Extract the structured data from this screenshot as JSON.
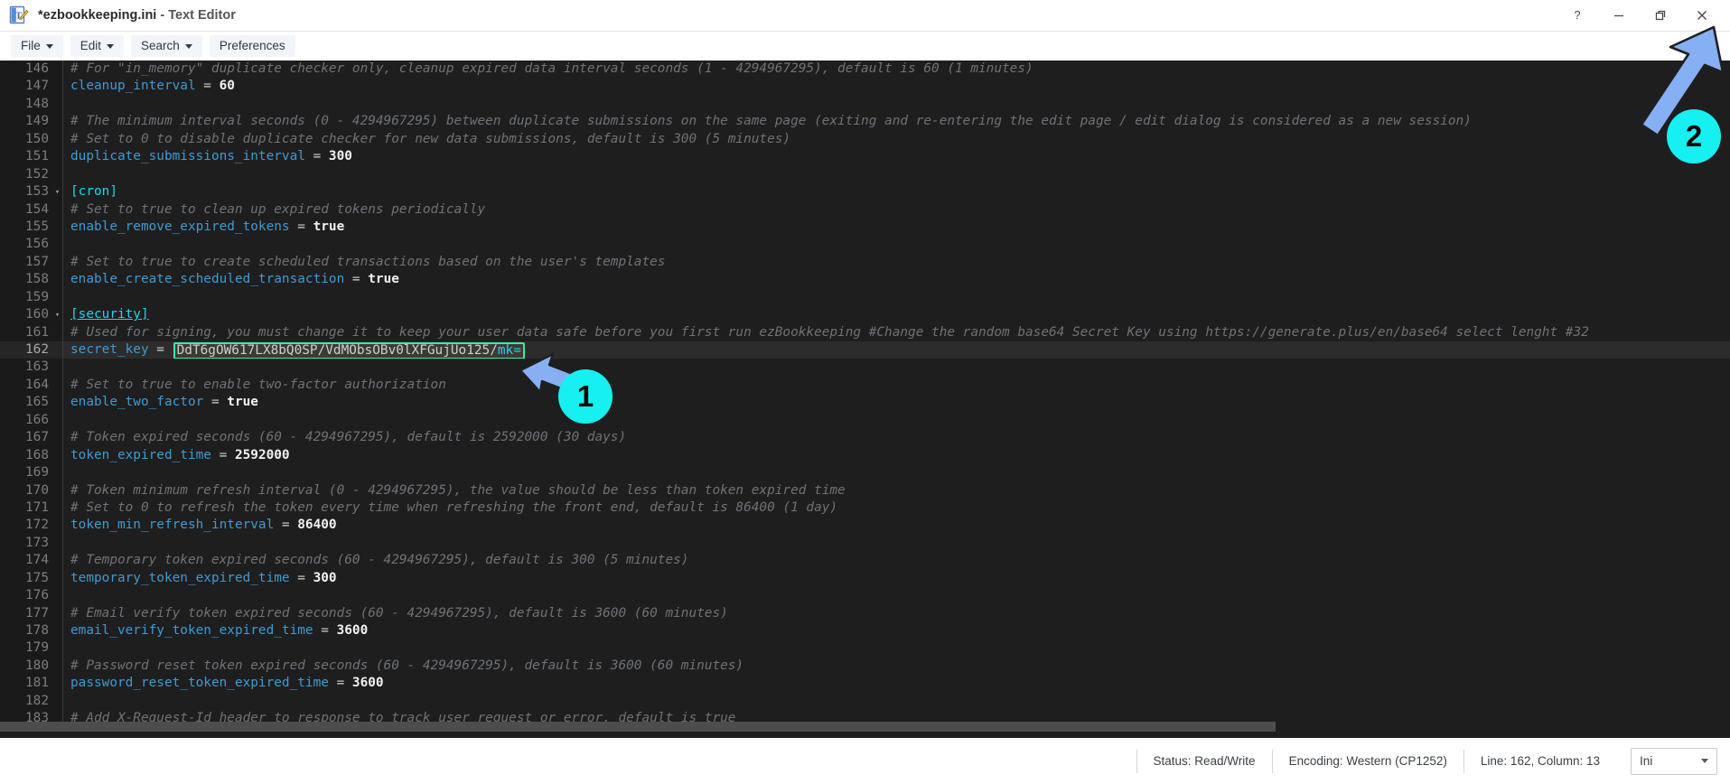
{
  "window": {
    "title": "*ezbookkeeping.ini",
    "title_suffix": " - Text Editor",
    "app_icon": "text-editor-icon",
    "controls": [
      {
        "name": "help-button",
        "glyph": "?"
      },
      {
        "name": "minimize-button",
        "glyph": "—"
      },
      {
        "name": "restore-button",
        "glyph": "❐"
      },
      {
        "name": "close-button",
        "glyph": "✕"
      }
    ]
  },
  "toolbar": {
    "items": [
      {
        "label": "File",
        "has_caret": true,
        "name": "menu-file"
      },
      {
        "label": "Edit",
        "has_caret": true,
        "name": "menu-edit"
      },
      {
        "label": "Search",
        "has_caret": true,
        "name": "menu-search"
      },
      {
        "label": "Preferences",
        "has_caret": false,
        "name": "menu-preferences"
      }
    ]
  },
  "editor": {
    "language": "ini",
    "first_visible_line": 146,
    "lines": [
      {
        "n": 146,
        "fold": "",
        "parts": [
          {
            "t": "comment",
            "s": "# For \"in_memory\" duplicate checker only, cleanup expired data interval seconds (1 - 4294967295), default is 60 (1 minutes)"
          }
        ]
      },
      {
        "n": 147,
        "fold": "",
        "parts": [
          {
            "t": "key",
            "s": "cleanup_interval"
          },
          {
            "t": "eq",
            "s": " = "
          },
          {
            "t": "val",
            "s": "60"
          }
        ]
      },
      {
        "n": 148,
        "fold": "",
        "parts": []
      },
      {
        "n": 149,
        "fold": "",
        "parts": [
          {
            "t": "comment",
            "s": "# The minimum interval seconds (0 - 4294967295) between duplicate submissions on the same page (exiting and re-entering the edit page / edit dialog is considered as a new session)"
          }
        ]
      },
      {
        "n": 150,
        "fold": "",
        "parts": [
          {
            "t": "comment",
            "s": "# Set to 0 to disable duplicate checker for new data submissions, default is 300 (5 minutes)"
          }
        ]
      },
      {
        "n": 151,
        "fold": "",
        "parts": [
          {
            "t": "key",
            "s": "duplicate_submissions_interval"
          },
          {
            "t": "eq",
            "s": " = "
          },
          {
            "t": "val",
            "s": "300"
          }
        ]
      },
      {
        "n": 152,
        "fold": "",
        "parts": []
      },
      {
        "n": 153,
        "fold": "▾",
        "parts": [
          {
            "t": "section",
            "s": "[cron]"
          }
        ]
      },
      {
        "n": 154,
        "fold": "",
        "parts": [
          {
            "t": "comment",
            "s": "# Set to true to clean up expired tokens periodically"
          }
        ]
      },
      {
        "n": 155,
        "fold": "",
        "parts": [
          {
            "t": "key",
            "s": "enable_remove_expired_tokens"
          },
          {
            "t": "eq",
            "s": " = "
          },
          {
            "t": "val",
            "s": "true"
          }
        ]
      },
      {
        "n": 156,
        "fold": "",
        "parts": []
      },
      {
        "n": 157,
        "fold": "",
        "parts": [
          {
            "t": "comment",
            "s": "# Set to true to create scheduled transactions based on the user's templates"
          }
        ]
      },
      {
        "n": 158,
        "fold": "",
        "parts": [
          {
            "t": "key",
            "s": "enable_create_scheduled_transaction"
          },
          {
            "t": "eq",
            "s": " = "
          },
          {
            "t": "val",
            "s": "true"
          }
        ]
      },
      {
        "n": 159,
        "fold": "",
        "parts": []
      },
      {
        "n": 160,
        "fold": "▾",
        "parts": [
          {
            "t": "section-u",
            "s": "[security]"
          }
        ]
      },
      {
        "n": 161,
        "fold": "",
        "parts": [
          {
            "t": "comment",
            "s": "# Used for signing, you must change it to keep your user data safe before you first run ezBookkeeping #Change the random base64 Secret Key using https://generate.plus/en/base64 select lenght #32"
          }
        ]
      },
      {
        "n": 162,
        "fold": "",
        "current": true,
        "parts": [
          {
            "t": "key",
            "s": "secret_key"
          },
          {
            "t": "eq",
            "s": " = "
          },
          {
            "t": "selbox",
            "s": "DdT6gOW617LX8bQ0SP/VdMObsOBv0lXFGujUo125/",
            "sel": "mk="
          }
        ]
      },
      {
        "n": 163,
        "fold": "",
        "parts": []
      },
      {
        "n": 164,
        "fold": "",
        "parts": [
          {
            "t": "comment",
            "s": "# Set to true to enable two-factor authorization"
          }
        ]
      },
      {
        "n": 165,
        "fold": "",
        "parts": [
          {
            "t": "key",
            "s": "enable_two_factor"
          },
          {
            "t": "eq",
            "s": " = "
          },
          {
            "t": "val",
            "s": "true"
          }
        ]
      },
      {
        "n": 166,
        "fold": "",
        "parts": []
      },
      {
        "n": 167,
        "fold": "",
        "parts": [
          {
            "t": "comment",
            "s": "# Token expired seconds (60 - 4294967295), default is 2592000 (30 days)"
          }
        ]
      },
      {
        "n": 168,
        "fold": "",
        "parts": [
          {
            "t": "key",
            "s": "token_expired_time"
          },
          {
            "t": "eq",
            "s": " = "
          },
          {
            "t": "val",
            "s": "2592000"
          }
        ]
      },
      {
        "n": 169,
        "fold": "",
        "parts": []
      },
      {
        "n": 170,
        "fold": "",
        "parts": [
          {
            "t": "comment",
            "s": "# Token minimum refresh interval (0 - 4294967295), the value should be less than token expired time"
          }
        ]
      },
      {
        "n": 171,
        "fold": "",
        "parts": [
          {
            "t": "comment",
            "s": "# Set to 0 to refresh the token every time when refreshing the front end, default is 86400 (1 day)"
          }
        ]
      },
      {
        "n": 172,
        "fold": "",
        "parts": [
          {
            "t": "key",
            "s": "token_min_refresh_interval"
          },
          {
            "t": "eq",
            "s": " = "
          },
          {
            "t": "val",
            "s": "86400"
          }
        ]
      },
      {
        "n": 173,
        "fold": "",
        "parts": []
      },
      {
        "n": 174,
        "fold": "",
        "parts": [
          {
            "t": "comment",
            "s": "# Temporary token expired seconds (60 - 4294967295), default is 300 (5 minutes)"
          }
        ]
      },
      {
        "n": 175,
        "fold": "",
        "parts": [
          {
            "t": "key",
            "s": "temporary_token_expired_time"
          },
          {
            "t": "eq",
            "s": " = "
          },
          {
            "t": "val",
            "s": "300"
          }
        ]
      },
      {
        "n": 176,
        "fold": "",
        "parts": []
      },
      {
        "n": 177,
        "fold": "",
        "parts": [
          {
            "t": "comment",
            "s": "# Email verify token expired seconds (60 - 4294967295), default is 3600 (60 minutes)"
          }
        ]
      },
      {
        "n": 178,
        "fold": "",
        "parts": [
          {
            "t": "key",
            "s": "email_verify_token_expired_time"
          },
          {
            "t": "eq",
            "s": " = "
          },
          {
            "t": "val",
            "s": "3600"
          }
        ]
      },
      {
        "n": 179,
        "fold": "",
        "parts": []
      },
      {
        "n": 180,
        "fold": "",
        "parts": [
          {
            "t": "comment",
            "s": "# Password reset token expired seconds (60 - 4294967295), default is 3600 (60 minutes)"
          }
        ]
      },
      {
        "n": 181,
        "fold": "",
        "parts": [
          {
            "t": "key",
            "s": "password_reset_token_expired_time"
          },
          {
            "t": "eq",
            "s": " = "
          },
          {
            "t": "val",
            "s": "3600"
          }
        ]
      },
      {
        "n": 182,
        "fold": "",
        "parts": []
      },
      {
        "n": 183,
        "fold": "",
        "parts": [
          {
            "t": "comment",
            "s": "# Add X-Request-Id header to response to track user request or error, default is true"
          }
        ]
      }
    ]
  },
  "statusbar": {
    "status": "Status: Read/Write",
    "encoding": "Encoding: Western (CP1252)",
    "position": "Line: 162, Column: 13",
    "language": "Ini"
  },
  "callouts": [
    {
      "number": "1",
      "target": "secret-key-value"
    },
    {
      "number": "2",
      "target": "close-button"
    }
  ],
  "colors": {
    "editor_bg": "#1e1e1e",
    "gutter_bg": "#1a1a1a",
    "accent_cyan": "#16f0f0",
    "selection_border": "#43e8a0",
    "arrow_blue": "#86aff4"
  }
}
